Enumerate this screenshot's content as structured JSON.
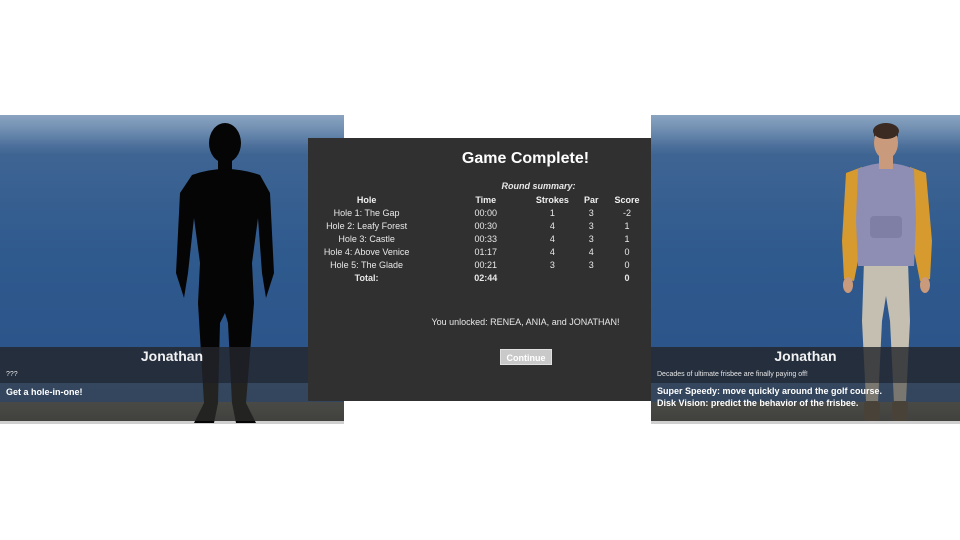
{
  "left_card": {
    "name": "Jonathan",
    "description": "???",
    "abilities": [
      "Get a hole-in-one!"
    ]
  },
  "summary": {
    "title": "Game Complete!",
    "subtitle": "Round summary:",
    "headers": {
      "hole": "Hole",
      "time": "Time",
      "strokes": "Strokes",
      "par": "Par",
      "score": "Score"
    },
    "rows": [
      {
        "hole": "Hole 1: The Gap",
        "time": "00:00",
        "strokes": "1",
        "par": "3",
        "score": "-2"
      },
      {
        "hole": "Hole 2: Leafy Forest",
        "time": "00:30",
        "strokes": "4",
        "par": "3",
        "score": "1"
      },
      {
        "hole": "Hole 3: Castle",
        "time": "00:33",
        "strokes": "4",
        "par": "3",
        "score": "1"
      },
      {
        "hole": "Hole 4: Above Venice",
        "time": "01:17",
        "strokes": "4",
        "par": "4",
        "score": "0"
      },
      {
        "hole": "Hole 5: The Glade",
        "time": "00:21",
        "strokes": "3",
        "par": "3",
        "score": "0"
      }
    ],
    "total": {
      "label": "Total:",
      "time": "02:44",
      "score": "0"
    },
    "unlocked_text": "You unlocked: RENEA, ANIA, and JONATHAN!",
    "continue_label": "Continue"
  },
  "right_card": {
    "name": "Jonathan",
    "description": "Decades of ultimate frisbee are finally paying off!",
    "abilities": [
      "Super Speedy: move quickly around the golf course.",
      "Disk Vision: predict the behavior of the frisbee."
    ]
  },
  "colors": {
    "sky": "#2f5a8e",
    "modal_bg": "#303030",
    "hoodie_body": "#8e8eb4",
    "hoodie_sleeves": "#d69a2e",
    "pants": "#c4bfb0"
  }
}
